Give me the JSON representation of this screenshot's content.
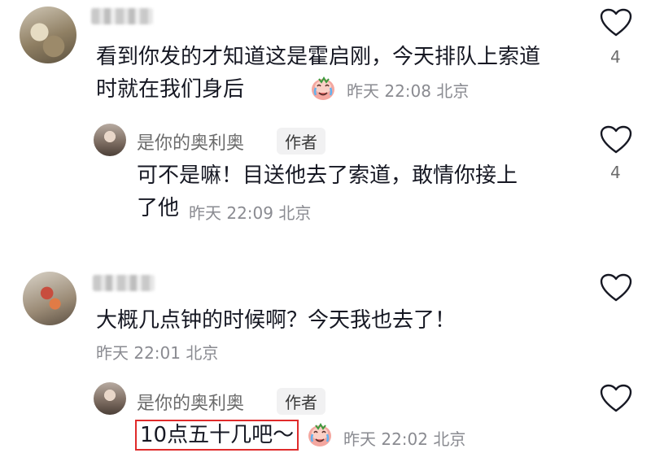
{
  "comments": [
    {
      "text": "看到你发的才知道这是霍启刚，今天排队上索道时就在我们身后",
      "time": "昨天 22:08 北京",
      "likes": "4",
      "reply": {
        "name": "是你的奥利奥",
        "badge": "作者",
        "text_line1": "可不是嘛！目送他去了索道，敢情你接上",
        "text_line2": "了他",
        "time": "昨天 22:09 北京",
        "likes": "4"
      }
    },
    {
      "text": "大概几点钟的时候啊？今天我也去了！",
      "time": "昨天 22:01 北京",
      "reply": {
        "name": "是你的奥利奥",
        "badge": "作者",
        "text": "10点五十几吧～",
        "time": "昨天 22:02 北京"
      }
    }
  ],
  "icons": {
    "like": "heart-outline-icon",
    "emoji": "crying-face-emoji"
  },
  "colors": {
    "highlight_border": "#e02b2b",
    "meta_text": "#8a8b91"
  }
}
